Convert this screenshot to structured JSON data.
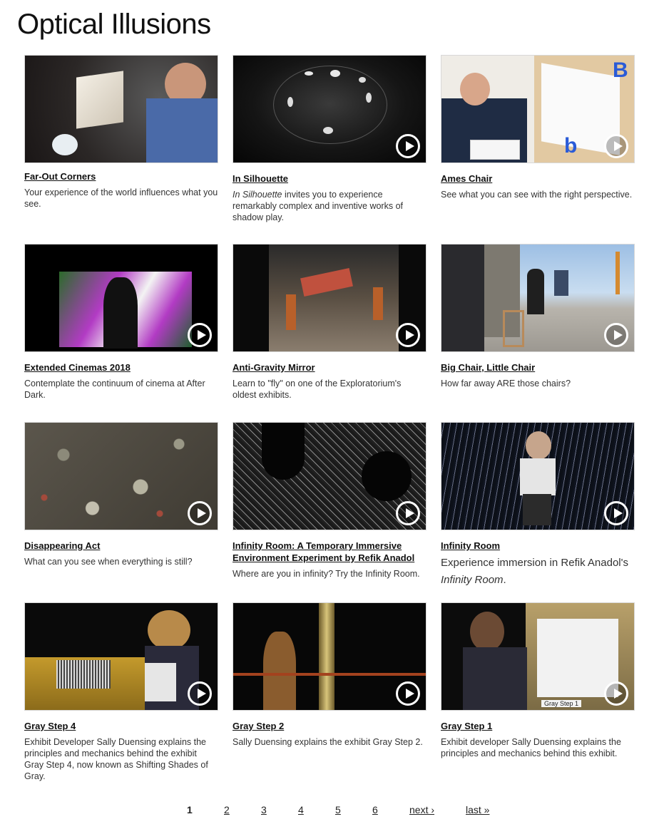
{
  "page": {
    "title": "Optical Illusions"
  },
  "cards": [
    {
      "title": "Far-Out Corners",
      "desc": "Your experience of the world influences what you see.",
      "video": false
    },
    {
      "title": "In Silhouette",
      "desc_em": "In Silhouette",
      "desc": " invites you to experience remarkably complex and inventive works of shadow play.",
      "video": true
    },
    {
      "title": "Ames Chair",
      "desc": "See what you can see with the right perspective.",
      "video": true
    },
    {
      "title": "Extended Cinemas 2018",
      "desc": "Contemplate the continuum of cinema at After Dark.",
      "video": true
    },
    {
      "title": "Anti-Gravity Mirror",
      "desc": "Learn to \"fly\" on one of the Exploratorium's oldest exhibits.",
      "video": true
    },
    {
      "title": "Big Chair, Little Chair",
      "desc": "How far away ARE those chairs?",
      "video": true
    },
    {
      "title": "Disappearing Act",
      "desc": "What can you see when everything is still?",
      "video": true
    },
    {
      "title": "Infinity Room: A Temporary Immersive Environment Experiment by Refik Anadol",
      "desc": "Where are you in infinity? Try the Infinity Room.",
      "video": true
    },
    {
      "title": "Infinity Room",
      "desc": "Experience immersion in Refik Anadol's",
      "desc_em2": "Infinity Room",
      "desc_tail": ".",
      "video": true
    },
    {
      "title": "Gray Step 4",
      "desc": "Exhibit Developer Sally Duensing explains the principles and mechanics behind the exhibit Gray Step 4, now known as Shifting Shades of Gray.",
      "video": true
    },
    {
      "title": "Gray Step 2",
      "desc": "Sally Duensing explains the exhibit Gray Step 2.",
      "video": true
    },
    {
      "title": "Gray Step 1",
      "desc": "Exhibit developer Sally Duensing explains the principles and mechanics behind this exhibit.",
      "video": true
    }
  ],
  "pager": {
    "current": "1",
    "pages": [
      "2",
      "3",
      "4",
      "5",
      "6"
    ],
    "next": "next ›",
    "last": "last »"
  },
  "thumb_labels": {
    "ames_big_letter": "B",
    "ames_small_letter": "b",
    "gray_step_1_sign": "Gray Step 1"
  }
}
